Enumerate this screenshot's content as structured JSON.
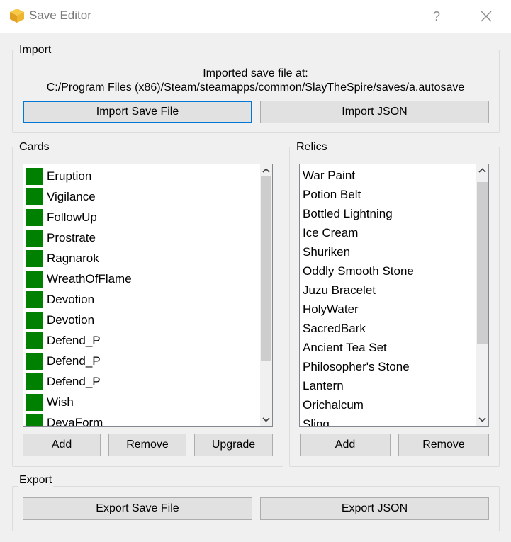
{
  "window": {
    "title": "Save Editor",
    "help_label": "?",
    "accent_color": "#0078d7"
  },
  "import": {
    "group_label": "Import",
    "info_line1": "Imported save file at:",
    "info_line2": "C:/Program Files (x86)/Steam/steamapps/common/SlayTheSpire/saves/a.autosave",
    "import_save_label": "Import Save File",
    "import_json_label": "Import JSON"
  },
  "cards": {
    "group_label": "Cards",
    "swatch_color": "#008000",
    "items": [
      "Eruption",
      "Vigilance",
      "FollowUp",
      "Prostrate",
      "Ragnarok",
      "WreathOfFlame",
      "Devotion",
      "Devotion",
      "Defend_P",
      "Defend_P",
      "Defend_P",
      "Wish",
      "DevaForm"
    ],
    "add_label": "Add",
    "remove_label": "Remove",
    "upgrade_label": "Upgrade"
  },
  "relics": {
    "group_label": "Relics",
    "items": [
      "War Paint",
      "Potion Belt",
      "Bottled Lightning",
      "Ice Cream",
      "Shuriken",
      "Oddly Smooth Stone",
      "Juzu Bracelet",
      "HolyWater",
      "SacredBark",
      "Ancient Tea Set",
      "Philosopher's Stone",
      "Lantern",
      "Orichalcum",
      "Sling"
    ],
    "add_label": "Add",
    "remove_label": "Remove"
  },
  "export": {
    "group_label": "Export",
    "export_save_label": "Export Save File",
    "export_json_label": "Export JSON"
  }
}
